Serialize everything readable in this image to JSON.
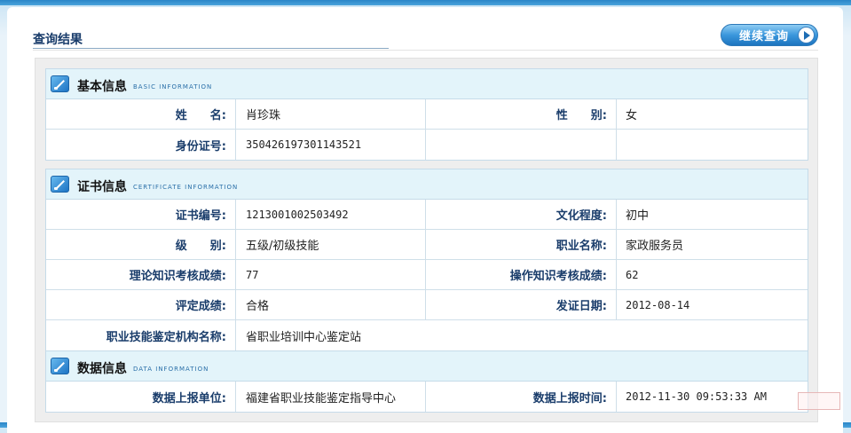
{
  "page": {
    "title": "查询结果"
  },
  "toolbar": {
    "continue_label": "继续查询"
  },
  "basic": {
    "title": "基本信息",
    "subtitle": "BASIC INFORMATION",
    "name_label": "姓　　名:",
    "name_value": "肖珍珠",
    "gender_label": "性　　别:",
    "gender_value": "女",
    "id_label": "身份证号:",
    "id_value": "350426197301143521"
  },
  "cert": {
    "title": "证书信息",
    "subtitle": "CERTIFICATE INFORMATION",
    "number_label": "证书编号:",
    "number_value": "1213001002503492",
    "education_label": "文化程度:",
    "education_value": "初中",
    "level_label": "级　　别:",
    "level_value": "五级/初级技能",
    "occupation_label": "职业名称:",
    "occupation_value": "家政服务员",
    "theory_label": "理论知识考核成绩:",
    "theory_value": "77",
    "practice_label": "操作知识考核成绩:",
    "practice_value": "62",
    "rating_label": "评定成绩:",
    "rating_value": "合格",
    "issue_date_label": "发证日期:",
    "issue_date_value": "2012-08-14",
    "org_label": "职业技能鉴定机构名称:",
    "org_value": "省职业培训中心鉴定站"
  },
  "data_info": {
    "title": "数据信息",
    "subtitle": "DATA INFORMATION",
    "unit_label": "数据上报单位:",
    "unit_value": "福建省职业技能鉴定指导中心",
    "time_label": "数据上报时间:",
    "time_value": "2012-11-30 09:53:33 AM"
  },
  "icons": {
    "continue": "play-circle-icon",
    "section": "pencil-icon"
  },
  "colors": {
    "accent": "#1e74c4",
    "label": "#1a3d6b",
    "section_header": "#e3f4fa"
  }
}
